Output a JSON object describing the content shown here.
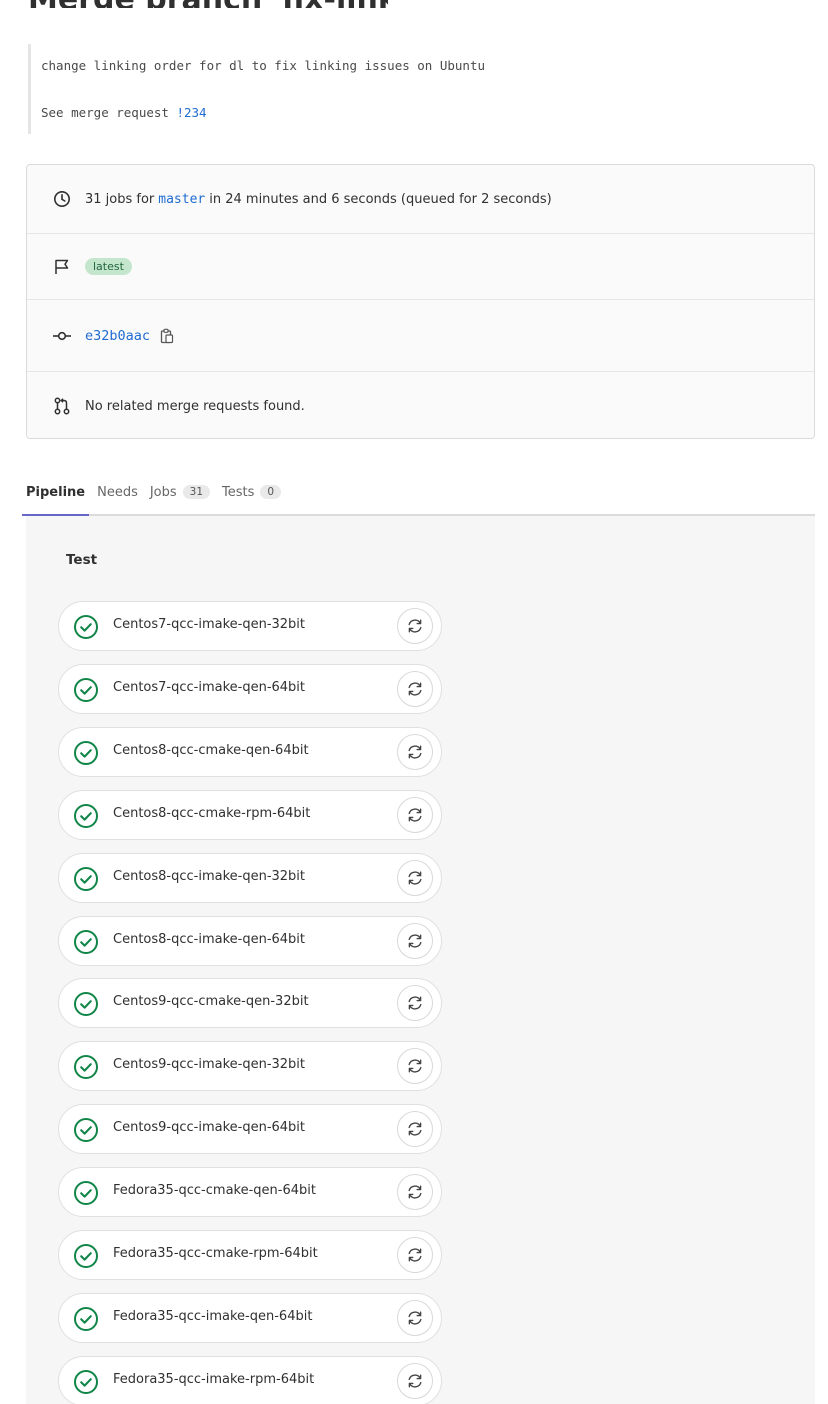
{
  "commit": {
    "title_partial": "Merge branch 'fix-linking'",
    "message_line1": "change linking order for dl to fix linking issues on Ubuntu",
    "message_line2_prefix": "See merge request ",
    "merge_request_ref": "!234"
  },
  "summary": {
    "jobs_prefix": "31 jobs for ",
    "branch": "master",
    "duration_text": " in 24 minutes and 6 seconds (queued for 2 seconds)",
    "badge": "latest",
    "sha": "e32b0aac",
    "merge_requests_text": "No related merge requests found."
  },
  "tabs": [
    {
      "label": "Pipeline",
      "count": null,
      "active": true
    },
    {
      "label": "Needs",
      "count": null,
      "active": false
    },
    {
      "label": "Jobs",
      "count": "31",
      "active": false
    },
    {
      "label": "Tests",
      "count": "0",
      "active": false
    }
  ],
  "stage": {
    "title": "Test",
    "jobs": [
      "Centos7-qcc-imake-qen-32bit",
      "Centos7-qcc-imake-qen-64bit",
      "Centos8-qcc-cmake-qen-64bit",
      "Centos8-qcc-cmake-rpm-64bit",
      "Centos8-qcc-imake-qen-32bit",
      "Centos8-qcc-imake-qen-64bit",
      "Centos9-qcc-cmake-qen-32bit",
      "Centos9-qcc-imake-qen-32bit",
      "Centos9-qcc-imake-qen-64bit",
      "Fedora35-qcc-cmake-qen-64bit",
      "Fedora35-qcc-cmake-rpm-64bit",
      "Fedora35-qcc-imake-qen-64bit",
      "Fedora35-qcc-imake-rpm-64bit"
    ]
  },
  "colors": {
    "success": "#108548",
    "link": "#1f6bd0",
    "active_tab": "#6666c4"
  }
}
